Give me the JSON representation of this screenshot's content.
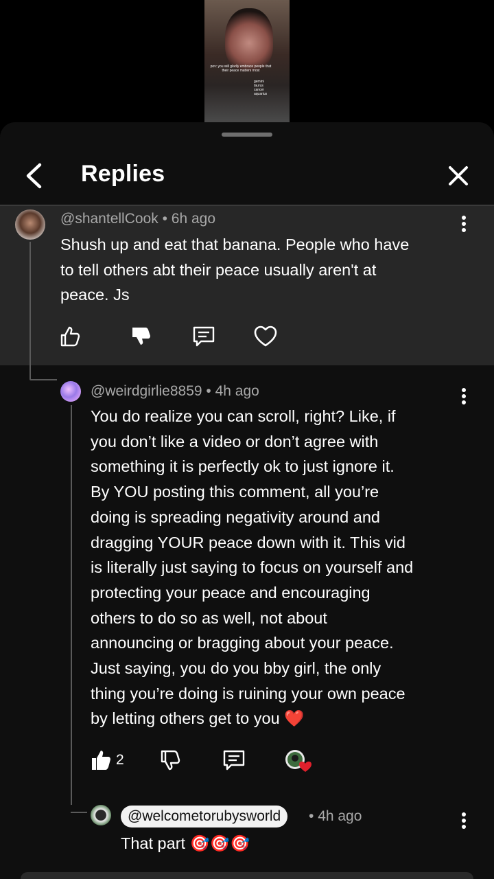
{
  "video": {
    "caption": "pov: you will gladly embrace people that their peace matters most",
    "signs": [
      "gemini",
      "taurus",
      "cancer",
      "aquarius"
    ]
  },
  "header": {
    "title": "Replies"
  },
  "parent_comment": {
    "author": "@shantellCook",
    "time": "6h ago",
    "text_lines": [
      "Shush up and eat that banana. People who have",
      "to tell others abt their peace usually aren't at",
      "peace. Js"
    ]
  },
  "reply_1": {
    "author": "@weirdgirlie8859",
    "time": "4h ago",
    "text_lines": [
      "You do realize you can scroll, right? Like, if",
      "you don’t like a video or don’t agree with",
      "something it is perfectly ok to just ignore it.",
      "By YOU posting this comment, all you’re",
      "doing is spreading negativity around and",
      "dragging YOUR peace down with it. This vid",
      "is literally just saying to focus on yourself and",
      "protecting your peace and encouraging",
      "others to do so as well, not about",
      "announcing or bragging about your peace.",
      "Just saying, you do you bby girl, the only",
      "thing you’re doing is ruining your own peace",
      "by letting others get to you ❤️"
    ],
    "like_count": "2"
  },
  "reply_2": {
    "mention": "@welcometorubysworld",
    "time": "4h ago",
    "text": "That part 🎯🎯🎯"
  },
  "colors": {
    "sheet": "#0f0f0f",
    "highlight": "#272727",
    "meta": "#a8a8a8"
  },
  "icons": [
    "chevron-left-icon",
    "close-icon",
    "more-vert-icon",
    "thumb-up-icon",
    "thumb-down-icon",
    "reply-icon",
    "heart-icon",
    "creator-heart-icon"
  ]
}
